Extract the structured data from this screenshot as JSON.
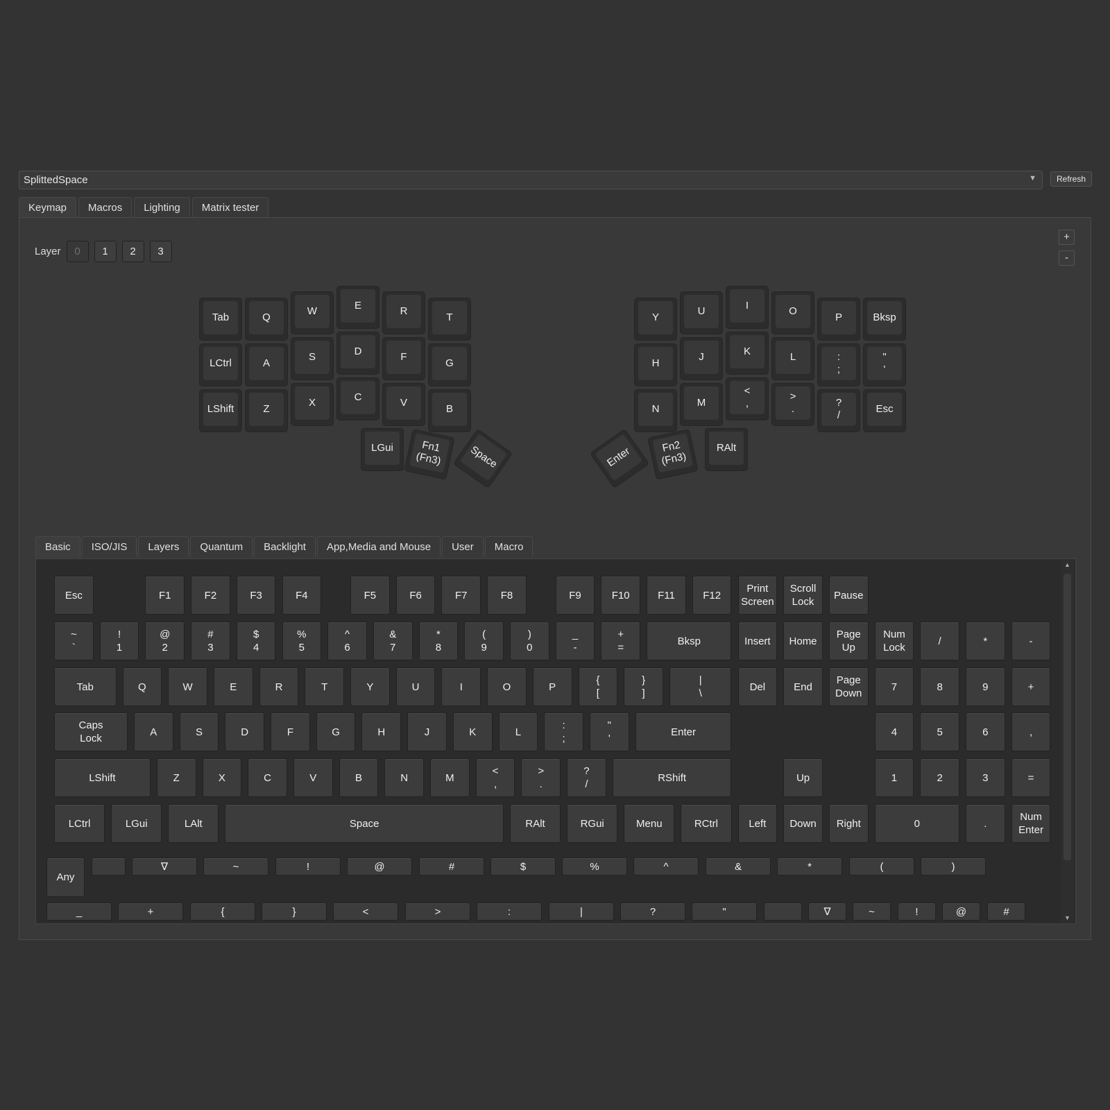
{
  "device": {
    "name": "SplittedSpace",
    "refresh_label": "Refresh"
  },
  "main_tabs": [
    "Keymap",
    "Macros",
    "Lighting",
    "Matrix tester"
  ],
  "layer": {
    "label": "Layer",
    "buttons": [
      "0",
      "1",
      "2",
      "3"
    ],
    "active": "0"
  },
  "layer_controls": {
    "add": "+",
    "remove": "-"
  },
  "split_keyboard": {
    "left": [
      [
        "Tab",
        "Q",
        "W",
        "E",
        "R",
        "T"
      ],
      [
        "LCtrl",
        "A",
        "S",
        "D",
        "F",
        "G"
      ],
      [
        "LShift",
        "Z",
        "X",
        "C",
        "V",
        "B"
      ]
    ],
    "left_thumb": [
      "LGui",
      "Fn1\n(Fn3)",
      "Space"
    ],
    "right": [
      [
        "Y",
        "U",
        "I",
        "O",
        "P",
        "Bksp"
      ],
      [
        "H",
        "J",
        "K",
        "L",
        ":\n;",
        "\"\n'"
      ],
      [
        "N",
        "M",
        "<\n,",
        ">\n.",
        "?\n/",
        "Esc"
      ]
    ],
    "right_thumb": [
      "Enter",
      "Fn2\n(Fn3)",
      "RAlt"
    ]
  },
  "keycode_tabs": [
    "Basic",
    "ISO/JIS",
    "Layers",
    "Quantum",
    "Backlight",
    "App,Media and Mouse",
    "User",
    "Macro"
  ],
  "keycodes": {
    "row1": [
      "Esc",
      "F1",
      "F2",
      "F3",
      "F4",
      "F5",
      "F6",
      "F7",
      "F8",
      "F9",
      "F10",
      "F11",
      "F12",
      "Print\nScreen",
      "Scroll\nLock",
      "Pause"
    ],
    "row2": [
      "~\n`",
      "!\n1",
      "@\n2",
      "#\n3",
      "$\n4",
      "%\n5",
      "^\n6",
      "&\n7",
      "*\n8",
      "(\n9",
      ")\n0",
      "_\n-",
      "+\n=",
      "Bksp",
      "Insert",
      "Home",
      "Page\nUp",
      "Num\nLock",
      "/",
      "*",
      "-"
    ],
    "row3": [
      "Tab",
      "Q",
      "W",
      "E",
      "R",
      "T",
      "Y",
      "U",
      "I",
      "O",
      "P",
      "{\n[",
      "}\n]",
      "|\n\\",
      "Del",
      "End",
      "Page\nDown",
      "7",
      "8",
      "9",
      "+"
    ],
    "row4": [
      "Caps\nLock",
      "A",
      "S",
      "D",
      "F",
      "G",
      "H",
      "J",
      "K",
      "L",
      ":\n;",
      "\"\n'",
      "Enter",
      "4",
      "5",
      "6",
      ","
    ],
    "row5": [
      "LShift",
      "Z",
      "X",
      "C",
      "V",
      "B",
      "N",
      "M",
      "<\n,",
      ">\n.",
      "?\n/",
      "RShift",
      "Up",
      "1",
      "2",
      "3",
      "="
    ],
    "row6": [
      "LCtrl",
      "LGui",
      "LAlt",
      "Space",
      "RAlt",
      "RGui",
      "Menu",
      "RCtrl",
      "Left",
      "Down",
      "Right",
      "0",
      ".",
      "Num\nEnter"
    ],
    "shifted1": [
      "Any",
      "",
      "∇",
      "~",
      "!",
      "@",
      "#",
      "$",
      "%",
      "^",
      "&",
      "*",
      "(",
      ")"
    ],
    "shifted2": [
      "_",
      "+",
      "{",
      "}",
      "<",
      ">",
      ":",
      "|",
      "?",
      "\"",
      "",
      "∇",
      "~",
      "!",
      "@",
      "#"
    ]
  }
}
